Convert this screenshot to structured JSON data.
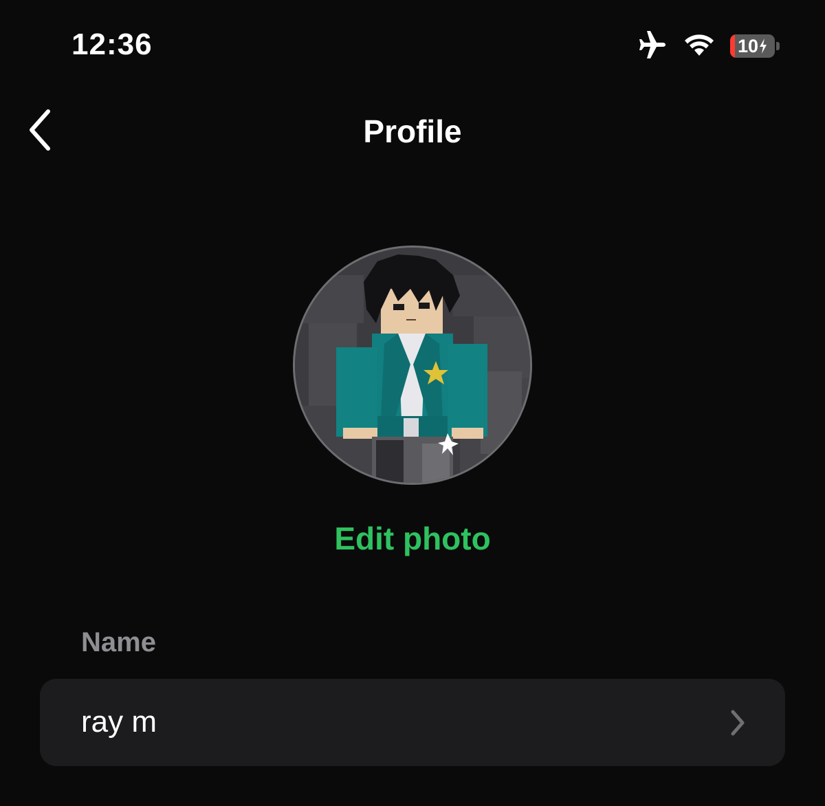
{
  "status_bar": {
    "time": "12:36",
    "battery_level": "10",
    "icons": [
      "airplane-icon",
      "wifi-icon",
      "battery-charging-icon"
    ]
  },
  "nav": {
    "title": "Profile",
    "back_icon": "chevron-left-icon"
  },
  "avatar": {
    "edit_label": "Edit photo"
  },
  "fields": {
    "name_label": "Name",
    "name_value": "ray m"
  },
  "colors": {
    "background": "#0a0a0a",
    "accent": "#2fc160",
    "row_background": "#1c1c1e",
    "secondary_text": "#8e8e93",
    "battery_low": "#ff3b30"
  }
}
